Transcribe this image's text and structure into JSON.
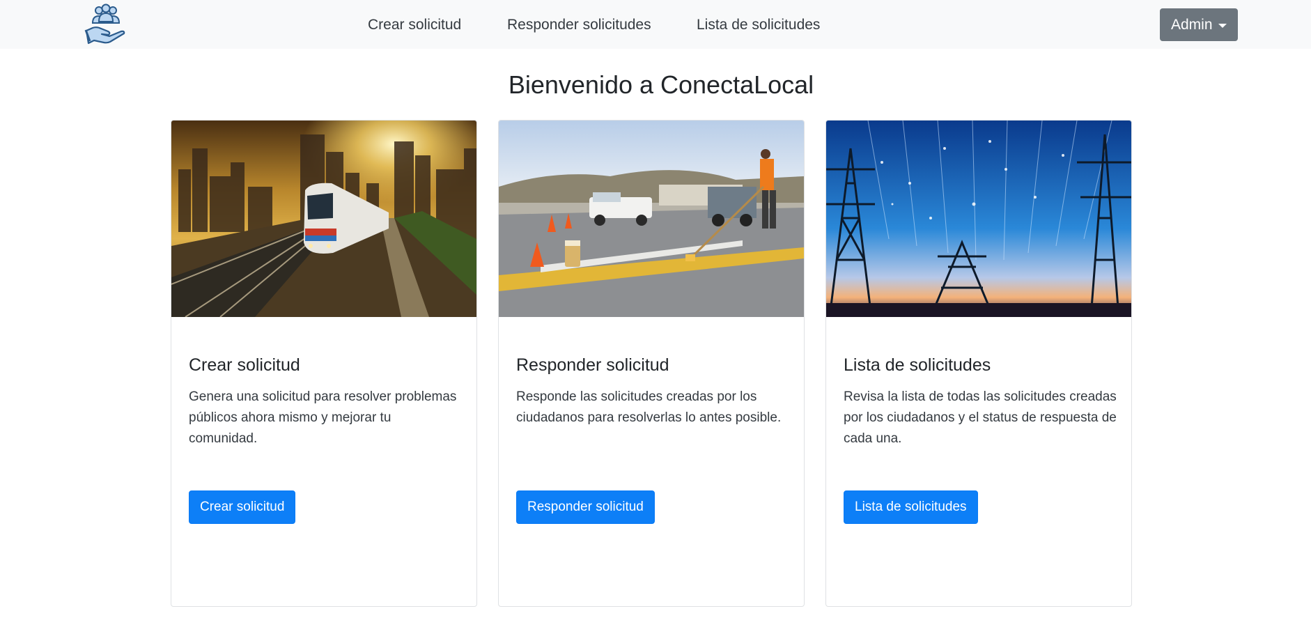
{
  "navbar": {
    "logo_icon": "community-hand-logo-icon",
    "links": [
      {
        "label": "Crear solicitud"
      },
      {
        "label": "Responder solicitudes"
      },
      {
        "label": "Lista de solicitudes"
      }
    ],
    "user_menu": {
      "label": "Admin",
      "icon": "caret-down-icon"
    }
  },
  "page": {
    "title": "Bienvenido a ConectaLocal"
  },
  "cards": [
    {
      "image": "city-train-image",
      "title": "Crear solicitud",
      "text": "Genera una solicitud para resolver problemas públicos ahora mismo y mejorar tu comunidad.",
      "button": "Crear solicitud"
    },
    {
      "image": "road-worker-painting-image",
      "title": "Responder solicitud",
      "text": "Responde las solicitudes creadas por los ciudadanos para resolverlas lo antes posible.",
      "button": "Responder solicitud"
    },
    {
      "image": "power-towers-image",
      "title": "Lista de solicitudes",
      "text": "Revisa la lista de todas las solicitudes creadas por los ciudadanos y el status de respuesta de cada una.",
      "button": "Lista de solicitudes"
    }
  ],
  "colors": {
    "primary": "#0d7ff7",
    "navbar_bg": "#f8f9fa",
    "secondary": "#6c757d"
  }
}
